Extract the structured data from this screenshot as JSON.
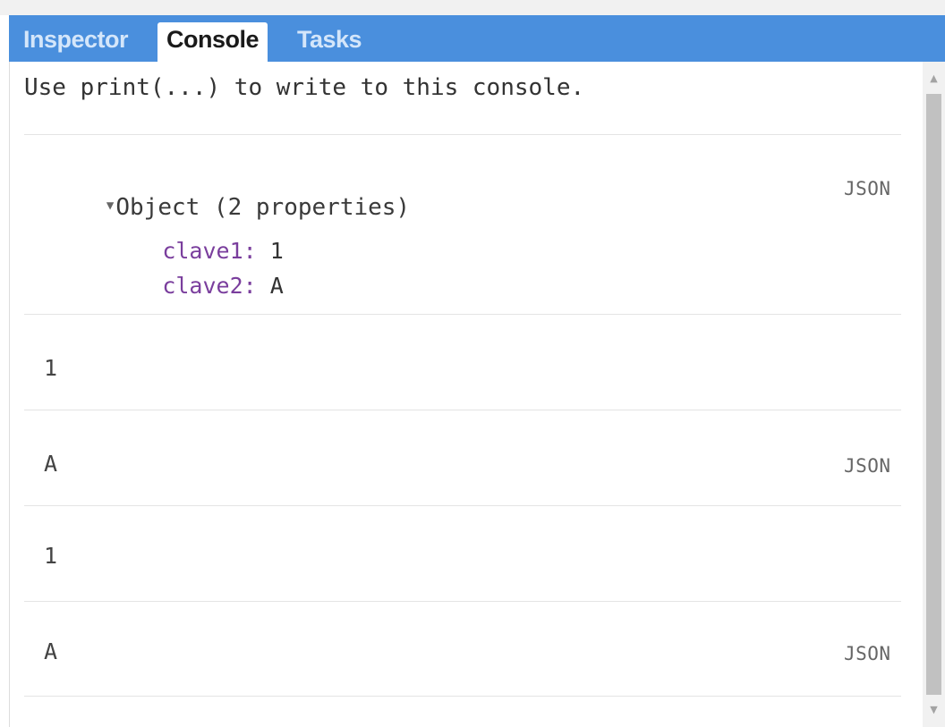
{
  "tabs": [
    {
      "label": "Inspector",
      "active": false
    },
    {
      "label": "Console",
      "active": true
    },
    {
      "label": "Tasks",
      "active": false
    }
  ],
  "console": {
    "intro": "Use print(...) to write to this console.",
    "object_entry": {
      "header": "Object (2 properties)",
      "json_label": "JSON",
      "properties": [
        {
          "key": "clave1:",
          "value": "1"
        },
        {
          "key": "clave2:",
          "value": "A"
        }
      ]
    },
    "entries": [
      {
        "text": "1",
        "json_label": ""
      },
      {
        "text": "A",
        "json_label": "JSON"
      },
      {
        "text": "1",
        "json_label": ""
      },
      {
        "text": "A",
        "json_label": "JSON"
      }
    ]
  },
  "icons": {
    "expand": "triangle-down-icon",
    "scroll_up": "arrow-up-icon",
    "scroll_down": "arrow-down-icon"
  },
  "colors": {
    "tabbar": "#4a8fdd",
    "property_key": "#7a3e9d"
  }
}
